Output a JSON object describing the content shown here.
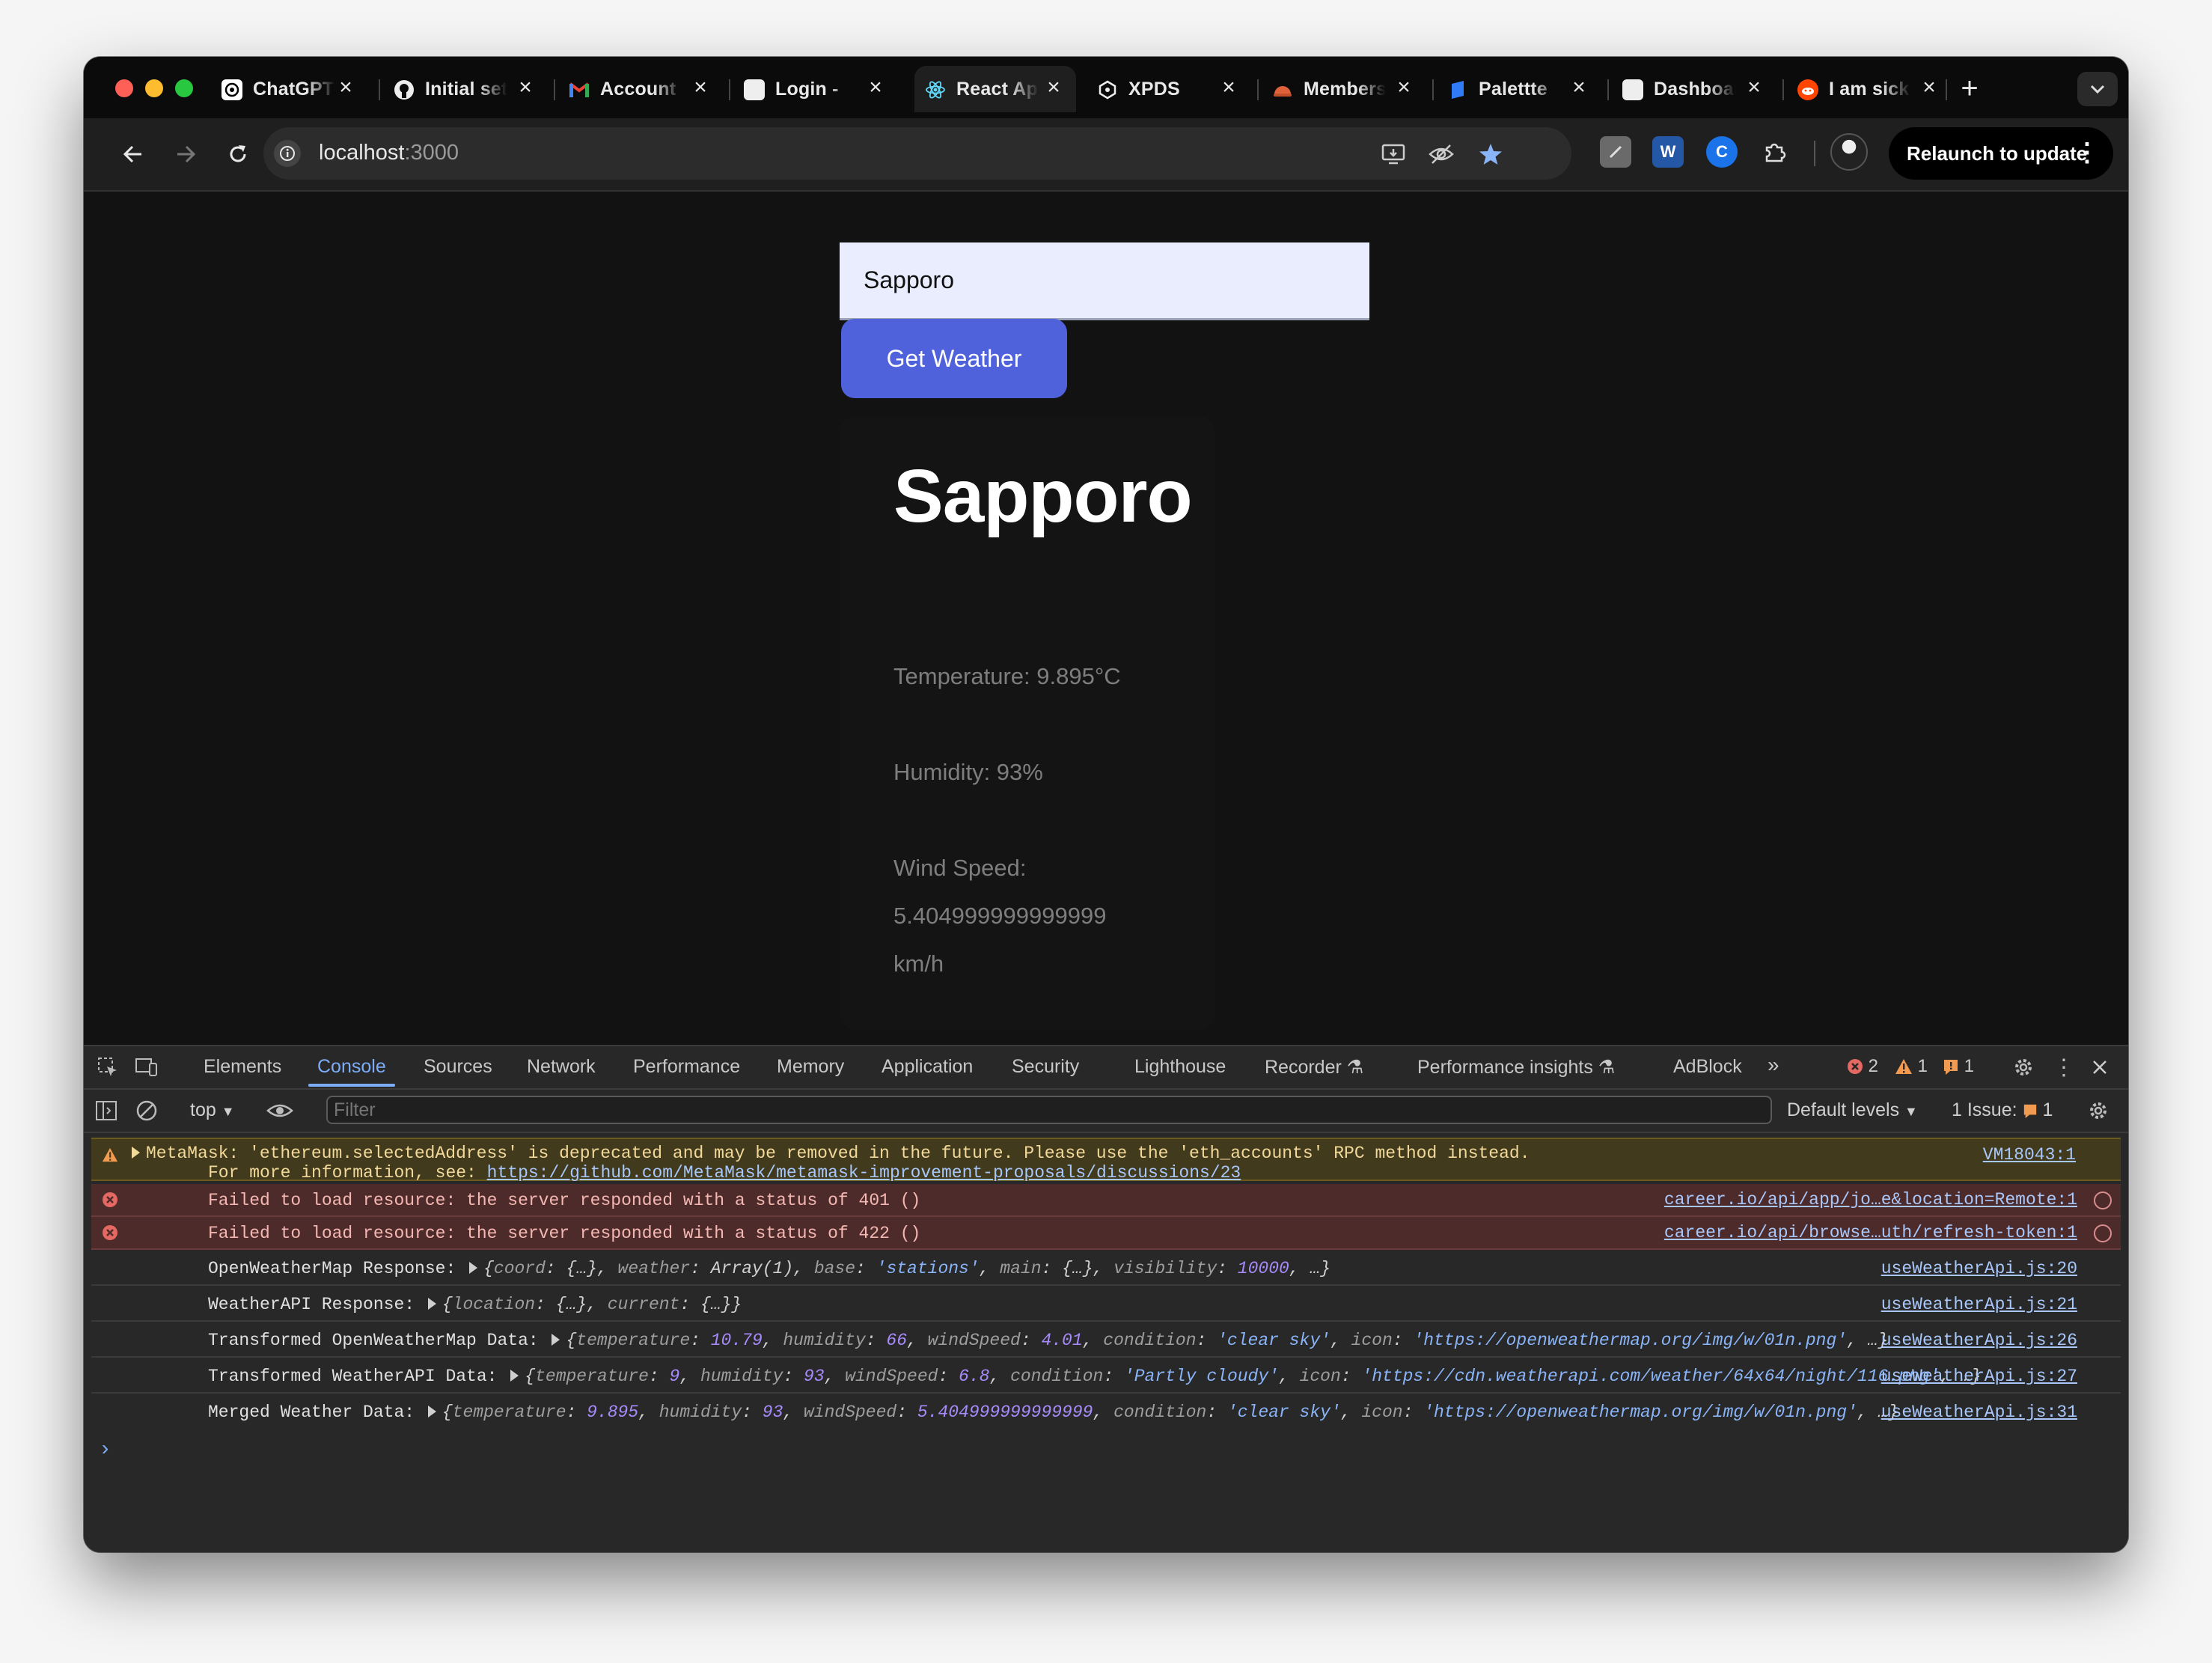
{
  "browser": {
    "tabs": [
      {
        "title": "ChatGPT",
        "icon": "chatgpt-icon",
        "active": false
      },
      {
        "title": "Initial setup",
        "icon": "github-icon",
        "active": false
      },
      {
        "title": "Account",
        "icon": "gmail-icon",
        "active": false
      },
      {
        "title": "Login - ",
        "icon": "page-icon",
        "active": false
      },
      {
        "title": "React App",
        "icon": "react-icon",
        "active": true
      },
      {
        "title": "XPDS",
        "icon": "openai-icon",
        "active": false
      },
      {
        "title": "Members",
        "icon": "helmet-icon",
        "active": false
      },
      {
        "title": "Palettte",
        "icon": "palette-icon",
        "active": false
      },
      {
        "title": "Dashboard",
        "icon": "page-icon",
        "active": false
      },
      {
        "title": "I am sick",
        "icon": "reddit-icon",
        "active": false
      }
    ],
    "new_tab": "+",
    "url_host": "localhost",
    "url_port": ":3000",
    "relaunch_label": "Relaunch to update"
  },
  "app": {
    "input_value": "Sapporo",
    "button_label": "Get Weather",
    "city": "Sapporo",
    "temperature": "Temperature: 9.895°C",
    "humidity": "Humidity: 93%",
    "wind_label": "Wind Speed:",
    "wind_value": "5.404999999999999",
    "wind_unit": "km/h"
  },
  "devtools": {
    "tabs": [
      "Elements",
      "Console",
      "Sources",
      "Network",
      "Performance",
      "Memory",
      "Application",
      "Security",
      "Lighthouse",
      "Recorder",
      "Performance insights",
      "AdBlock"
    ],
    "active_tab": "Console",
    "errors_count": "2",
    "warnings_count": "1",
    "issues_count": "1",
    "context": "top",
    "filter_placeholder": "Filter",
    "levels": "Default levels",
    "issues_label": "1 Issue:",
    "issues_badge": "1",
    "messages": {
      "warn_line1": "MetaMask: 'ethereum.selectedAddress' is deprecated and may be removed in the future. Please use the 'eth_accounts' RPC method instead.",
      "warn_line2_prefix": "For more information, see: ",
      "warn_link": "https://github.com/MetaMask/metamask-improvement-proposals/discussions/23",
      "warn_src": "VM18043:1",
      "err1": "Failed to load resource: the server responded with a status of 401 ()",
      "err1_src": "career.io/api/app/jo…e&location=Remote:1",
      "err2": "Failed to load resource: the server responded with a status of 422 ()",
      "err2_src": "career.io/api/browse…uth/refresh-token:1",
      "log1_label": "OpenWeatherMap Response:",
      "log1_src": "useWeatherApi.js:20",
      "log2_label": "WeatherAPI Response:",
      "log2_src": "useWeatherApi.js:21",
      "log3_label": "Transformed OpenWeatherMap Data:",
      "log3_src": "useWeatherApi.js:26",
      "log4_label": "Transformed WeatherAPI Data:",
      "log4_src": "useWeatherApi.js:27",
      "log5_label": "Merged Weather Data:",
      "log5_src": "useWeatherApi.js:31"
    },
    "log_objects": {
      "log1": [
        {
          "k": "coord",
          "v": "{…}",
          "t": "o"
        },
        {
          "k": "weather",
          "v": "Array(1)",
          "t": "o"
        },
        {
          "k": "base",
          "v": "'stations'",
          "t": "s"
        },
        {
          "k": "main",
          "v": "{…}",
          "t": "o"
        },
        {
          "k": "visibility",
          "v": "10000",
          "t": "n"
        }
      ],
      "log2": [
        {
          "k": "location",
          "v": "{…}",
          "t": "o"
        },
        {
          "k": "current",
          "v": "{…}",
          "t": "o"
        }
      ],
      "log3": [
        {
          "k": "temperature",
          "v": "10.79",
          "t": "n"
        },
        {
          "k": "humidity",
          "v": "66",
          "t": "n"
        },
        {
          "k": "windSpeed",
          "v": "4.01",
          "t": "n"
        },
        {
          "k": "condition",
          "v": "'clear sky'",
          "t": "s"
        },
        {
          "k": "icon",
          "v": "'https://openweathermap.org/img/w/01n.png'",
          "t": "s"
        }
      ],
      "log4": [
        {
          "k": "temperature",
          "v": "9",
          "t": "n"
        },
        {
          "k": "humidity",
          "v": "93",
          "t": "n"
        },
        {
          "k": "windSpeed",
          "v": "6.8",
          "t": "n"
        },
        {
          "k": "condition",
          "v": "'Partly cloudy'",
          "t": "s"
        },
        {
          "k": "icon",
          "v": "'https://cdn.weatherapi.com/weather/64x64/night/116.png'",
          "t": "s"
        }
      ],
      "log5": [
        {
          "k": "temperature",
          "v": "9.895",
          "t": "n"
        },
        {
          "k": "humidity",
          "v": "93",
          "t": "n"
        },
        {
          "k": "windSpeed",
          "v": "5.404999999999999",
          "t": "n"
        },
        {
          "k": "condition",
          "v": "'clear sky'",
          "t": "s"
        },
        {
          "k": "icon",
          "v": "'https://openweathermap.org/img/w/01n.png'",
          "t": "s"
        }
      ],
      "truncated_log1": true,
      "truncated_log2": false,
      "truncated_log3": true,
      "truncated_log4": true,
      "truncated_log5": true
    }
  },
  "colors": {
    "accent_button": "#4f62dc",
    "devtools_active": "#7cacf8",
    "error_bg": "#4e2b2b",
    "warning_bg": "#413a1c"
  }
}
